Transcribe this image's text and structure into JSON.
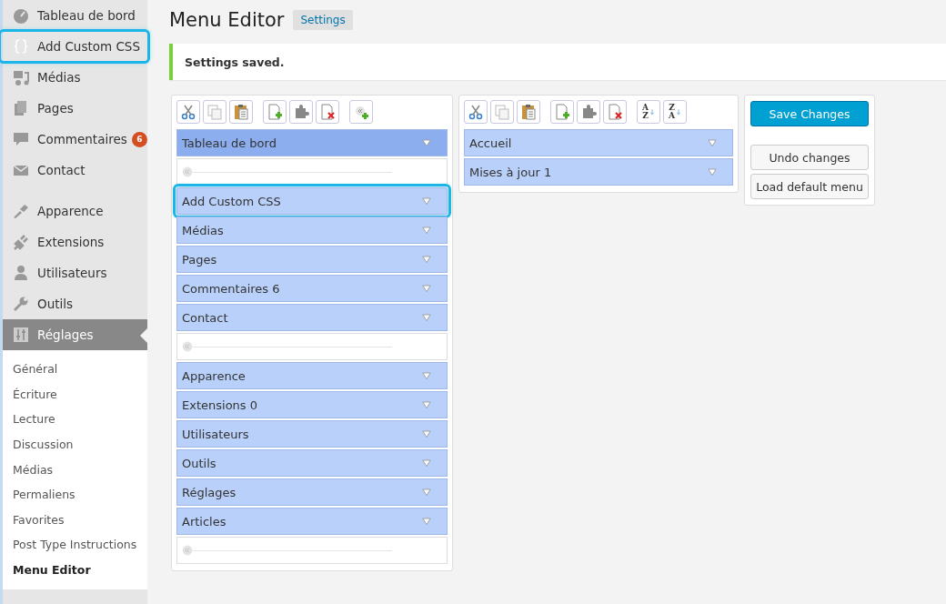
{
  "sidebar": {
    "items": [
      {
        "label": "Tableau de bord",
        "selected": false,
        "highlighted": false
      },
      {
        "label": "Add Custom CSS",
        "selected": false,
        "highlighted": true
      },
      {
        "label": "Médias",
        "selected": false,
        "highlighted": false
      },
      {
        "label": "Pages",
        "selected": false,
        "highlighted": false
      },
      {
        "label": "Commentaires",
        "badge": "6",
        "selected": false,
        "highlighted": false
      },
      {
        "label": "Contact",
        "selected": false,
        "highlighted": false,
        "gap_after": true
      },
      {
        "label": "Apparence",
        "selected": false,
        "highlighted": false
      },
      {
        "label": "Extensions",
        "selected": false,
        "highlighted": false
      },
      {
        "label": "Utilisateurs",
        "selected": false,
        "highlighted": false
      },
      {
        "label": "Outils",
        "selected": false,
        "highlighted": false
      },
      {
        "label": "Réglages",
        "selected": true,
        "highlighted": false,
        "children": [
          {
            "label": "Général",
            "selected": false
          },
          {
            "label": "Écriture",
            "selected": false
          },
          {
            "label": "Lecture",
            "selected": false
          },
          {
            "label": "Discussion",
            "selected": false
          },
          {
            "label": "Médias",
            "selected": false
          },
          {
            "label": "Permaliens",
            "selected": false
          },
          {
            "label": "Favorites",
            "selected": false
          },
          {
            "label": "Post Type Instructions",
            "selected": false
          },
          {
            "label": "Menu Editor",
            "selected": true
          }
        ]
      }
    ]
  },
  "page": {
    "title": "Menu Editor",
    "title_button": "Settings",
    "notice": "Settings saved."
  },
  "menu_column": {
    "items": [
      {
        "kind": "item",
        "label": "Tableau de bord",
        "selected": true,
        "highlighted": false
      },
      {
        "kind": "separator"
      },
      {
        "kind": "item",
        "label": "Add Custom CSS",
        "selected": false,
        "highlighted": true
      },
      {
        "kind": "item",
        "label": "Médias",
        "selected": false,
        "highlighted": false
      },
      {
        "kind": "item",
        "label": "Pages",
        "selected": false,
        "highlighted": false
      },
      {
        "kind": "item",
        "label": "Commentaires 6",
        "selected": false,
        "highlighted": false
      },
      {
        "kind": "item",
        "label": "Contact",
        "selected": false,
        "highlighted": false
      },
      {
        "kind": "separator"
      },
      {
        "kind": "item",
        "label": "Apparence",
        "selected": false,
        "highlighted": false
      },
      {
        "kind": "item",
        "label": "Extensions 0",
        "selected": false,
        "highlighted": false
      },
      {
        "kind": "item",
        "label": "Utilisateurs",
        "selected": false,
        "highlighted": false
      },
      {
        "kind": "item",
        "label": "Outils",
        "selected": false,
        "highlighted": false
      },
      {
        "kind": "item",
        "label": "Réglages",
        "selected": false,
        "highlighted": false
      },
      {
        "kind": "item",
        "label": "Articles",
        "selected": false,
        "highlighted": false
      },
      {
        "kind": "separator"
      }
    ]
  },
  "submenu_column": {
    "sort_buttons": [
      {
        "top": "A",
        "bottom": "Z"
      },
      {
        "top": "Z",
        "bottom": "A"
      }
    ],
    "items": [
      {
        "kind": "item",
        "label": "Accueil",
        "selected": false,
        "highlighted": false
      },
      {
        "kind": "item",
        "label": "Mises à jour 1",
        "selected": false,
        "highlighted": false
      }
    ]
  },
  "actions": [
    {
      "label": "Save Changes",
      "kind": "primary"
    },
    {
      "label": "Undo changes",
      "kind": "secondary"
    },
    {
      "label": "Load default menu",
      "kind": "secondary"
    }
  ]
}
